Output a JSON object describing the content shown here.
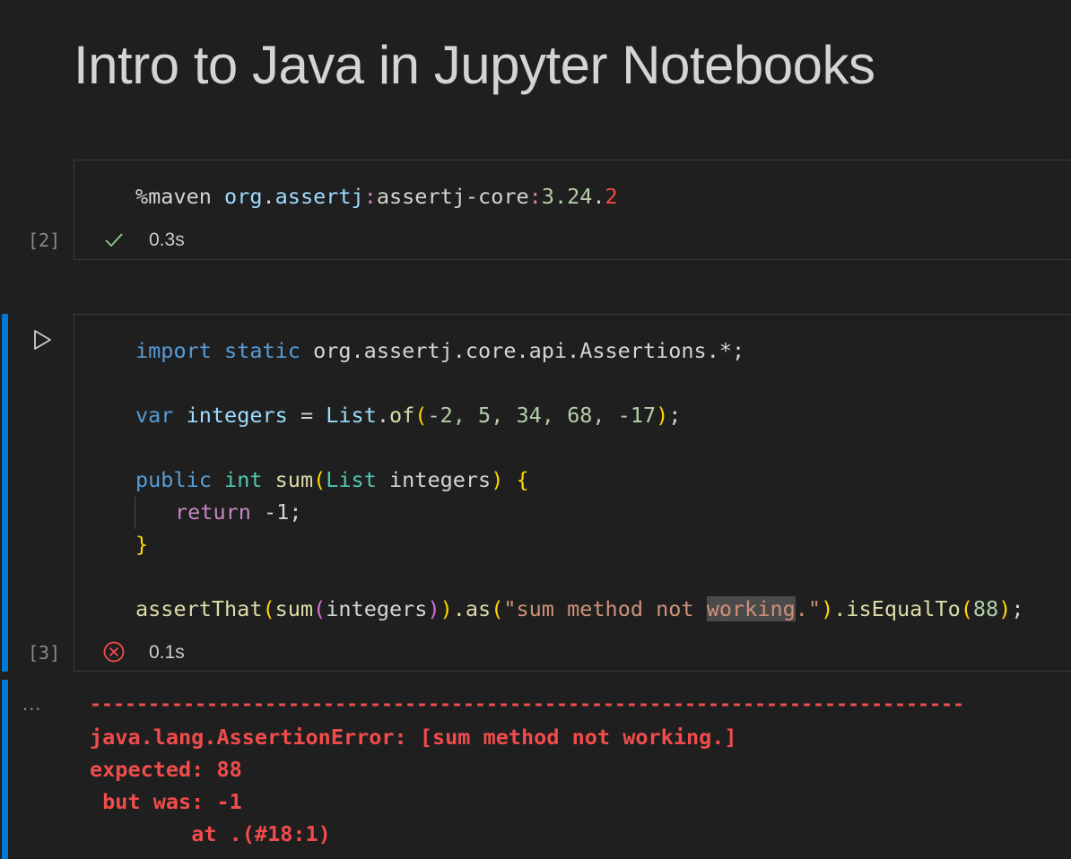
{
  "notebook": {
    "title": "Intro to Java in Jupyter Notebooks"
  },
  "cells": [
    {
      "exec_count": "[2]",
      "status": "success",
      "status_icon": "check-icon",
      "time": "0.3s",
      "code": {
        "magic": "%maven",
        "group_a": "org",
        "dot": ".",
        "group_b": "assertj",
        "colon1": ":",
        "artifact": "assertj-core",
        "colon2": ":",
        "version_a": "3.24",
        "version_dot": ".",
        "version_b": "2"
      }
    },
    {
      "exec_count": "[3]",
      "status": "error",
      "status_icon": "error-circle-icon",
      "time": "0.1s",
      "code": {
        "l1_import": "import",
        "l1_static": "static",
        "l1_pkg": "org.assertj.core.api.Assertions.*;",
        "l2_var": "var",
        "l2_name": "integers",
        "l2_eq": " = ",
        "l2_list": "List",
        "l2_dot": ".",
        "l2_of": "of",
        "l2_open": "(",
        "l2_args": "-2, 5, 34, 68, -17",
        "l2_close": ")",
        "l2_semi": ";",
        "l3_public": "public",
        "l3_int": "int",
        "l3_sum": "sum",
        "l3_open": "(",
        "l3_type": "List",
        "l3_param": " integers",
        "l3_close": ")",
        "l3_brace": "{",
        "l4_return": "return",
        "l4_val": " -1;",
        "l5_brace": "}",
        "l6_assert": "assertThat",
        "l6_p1": "(",
        "l6_sum": "sum",
        "l6_p2": "(",
        "l6_arg": "integers",
        "l6_p2c": ")",
        "l6_p1c": ")",
        "l6_as": ".as",
        "l6_p3": "(",
        "l6_str_a": "\"sum method not ",
        "l6_str_hl": "working",
        "l6_str_b": ".\"",
        "l6_p3c": ")",
        "l6_iseq": ".isEqualTo",
        "l6_p4": "(",
        "l6_num": "88",
        "l6_p4c": ")",
        "l6_semi": ";"
      }
    }
  ],
  "output": {
    "more_label": "...",
    "separator": "---------------------------------------------------------------------------",
    "line1": "java.lang.AssertionError: [sum method not working.]",
    "line2": "expected: 88",
    "line3": " but was: -1",
    "line4": "\tat .(#18:1)"
  },
  "colors": {
    "accent_bar": "#0078d4",
    "error": "#f14c4c",
    "success": "#89d185"
  }
}
